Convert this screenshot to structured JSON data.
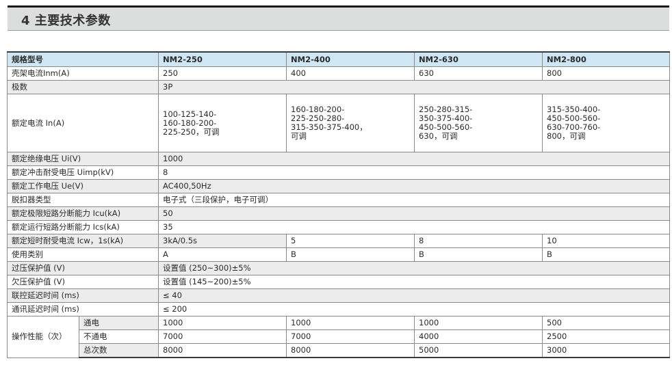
{
  "section_title": "4 主要技术参数",
  "header": {
    "label": "规格型号",
    "models": [
      "NM2-250",
      "NM2-400",
      "NM2-630",
      "NM2-800"
    ]
  },
  "rows": {
    "frame_current": {
      "label": "壳架电流Inm(A)",
      "values": [
        "250",
        "400",
        "630",
        "800"
      ]
    },
    "poles": {
      "label": "极数",
      "value": "3P"
    },
    "rated_current": {
      "label": "额定电流 In(A)",
      "values": [
        [
          "100-125-140-",
          "160-180-200-",
          "225-250，可调"
        ],
        [
          "160-180-200-",
          "225-250-280-",
          "315-350-375-400，",
          "可调"
        ],
        [
          "250-280-315-",
          "350-375-400-",
          "450-500-560-",
          "630，可调"
        ],
        [
          "315-350-400-",
          "450-500-560-",
          "630-700-760-",
          "800，可调"
        ]
      ]
    },
    "insulation_voltage": {
      "label": "额定绝缘电压 Ui(V)",
      "value": "1000"
    },
    "impulse_voltage": {
      "label": "额定冲击耐受电压 Uimp(kV)",
      "value": "8"
    },
    "operating_voltage": {
      "label": "额定工作电压 Ue(V)",
      "value": "AC400,50Hz"
    },
    "release_type": {
      "label": "脱扣器类型",
      "value": "电子式（三段保护，电子可调）"
    },
    "icu": {
      "label": "额定极限短路分断能力 Icu(kA)",
      "value": "50"
    },
    "ics": {
      "label": "额定运行短路分断能力 Ics(kA)",
      "value": "35"
    },
    "icw": {
      "label": "额定短时耐受电流 Icw，1s(kA)",
      "values": [
        "3kA/0.5s",
        "5",
        "8",
        "10"
      ]
    },
    "category": {
      "label": "使用类别",
      "values": [
        "A",
        "B",
        "B",
        "B"
      ]
    },
    "overvoltage": {
      "label": "过压保护值 (V)",
      "value": "设置值 (250~300)±5%"
    },
    "undervoltage": {
      "label": "欠压保护值 (V)",
      "value": "设置值 (145~200)±5%"
    },
    "interlock_delay": {
      "label": "联控延迟时间 (ms)",
      "value": "≤ 40"
    },
    "comm_delay": {
      "label": "通讯延迟时间 (ms)",
      "value": "≤ 200"
    },
    "operation": {
      "label": "操作性能（次）",
      "energized": {
        "label": "通电",
        "values": [
          "1000",
          "1000",
          "1000",
          "500"
        ]
      },
      "non_energized": {
        "label": "不通电",
        "values": [
          "7000",
          "7000",
          "4000",
          "2500"
        ]
      },
      "total": {
        "label": "总次数",
        "values": [
          "8000",
          "8000",
          "5000",
          "3000"
        ]
      }
    }
  },
  "colors": {
    "header_row_bg": "#cfe7f5",
    "title_bar_bg": "#dcdddd",
    "shaded_row_bg": "#ececec"
  }
}
